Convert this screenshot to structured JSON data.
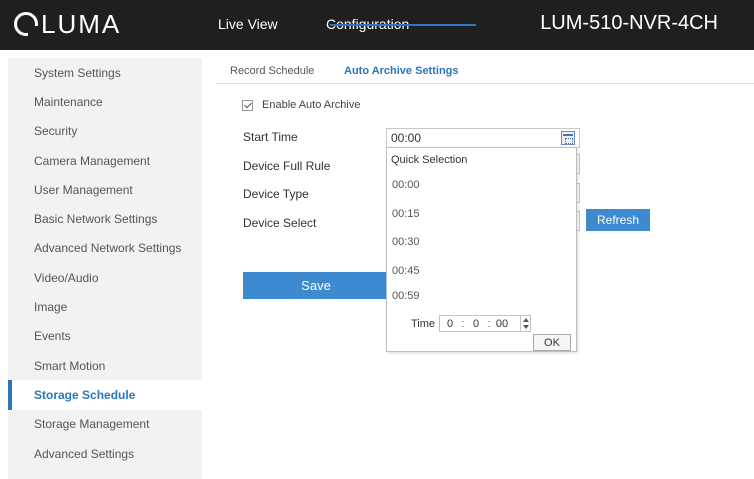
{
  "header": {
    "logo_text": "LUMA",
    "nav": [
      "Live View",
      "Configuration"
    ],
    "device_name": "LUM-510-NVR-4CH"
  },
  "sidebar": {
    "items": [
      {
        "label": "System Settings",
        "active": false
      },
      {
        "label": "Maintenance",
        "active": false
      },
      {
        "label": "Security",
        "active": false
      },
      {
        "label": "Camera Management",
        "active": false
      },
      {
        "label": "User Management",
        "active": false
      },
      {
        "label": "Basic Network Settings",
        "active": false
      },
      {
        "label": "Advanced Network Settings",
        "active": false
      },
      {
        "label": "Video/Audio",
        "active": false
      },
      {
        "label": "Image",
        "active": false
      },
      {
        "label": "Events",
        "active": false
      },
      {
        "label": "Smart Motion",
        "active": false
      },
      {
        "label": "Storage Schedule",
        "active": true
      },
      {
        "label": "Storage Management",
        "active": false
      },
      {
        "label": "Advanced Settings",
        "active": false
      }
    ]
  },
  "tabs": [
    {
      "label": "Record Schedule",
      "active": false
    },
    {
      "label": "Auto Archive Settings",
      "active": true
    }
  ],
  "form": {
    "enable_label": "Enable Auto Archive",
    "enable_checked": true,
    "start_time_label": "Start Time",
    "start_time_value": "00:00",
    "device_full_rule_label": "Device Full Rule",
    "device_type_label": "Device Type",
    "device_select_label": "Device Select",
    "refresh_label": "Refresh",
    "save_label": "Save"
  },
  "time_picker": {
    "title": "Quick Selection",
    "options": [
      "00:00",
      "00:15",
      "00:30",
      "00:45",
      "00:59"
    ],
    "time_label": "Time",
    "hour": "0",
    "minute": "0",
    "second": "00",
    "ok_label": "OK"
  },
  "colors": {
    "topbar": "#1f1f1f",
    "accent": "#3d8ad1",
    "sidebar_bg": "#f2f2f2",
    "active_text": "#2d76b9"
  }
}
